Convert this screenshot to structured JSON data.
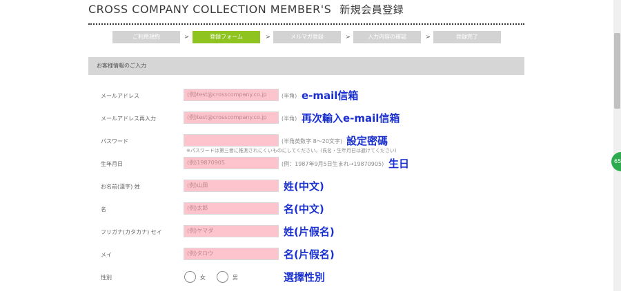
{
  "header": {
    "title": "CROSS COMPANY COLLECTION MEMBER'S",
    "title_jp": "新規会員登録"
  },
  "steps": [
    {
      "label": "ご利用規約",
      "active": false
    },
    {
      "label": "登録フォーム",
      "active": true
    },
    {
      "label": "メルマガ登録",
      "active": false
    },
    {
      "label": "入力内容の確認",
      "active": false
    },
    {
      "label": "登録完了",
      "active": false
    }
  ],
  "step_separator": ">",
  "section": {
    "title": "お客様情報のご入力"
  },
  "fields": {
    "email": {
      "label": "メールアドレス",
      "placeholder": "(例)test@crosscompany.co.jp",
      "hint": "(半角)",
      "annotation": "e-mail信箱"
    },
    "email_confirm": {
      "label": "メールアドレス再入力",
      "placeholder": "(例)test@crosscompany.co.jp",
      "hint": "(半角)",
      "annotation": "再次輸入e-mail信箱"
    },
    "password": {
      "label": "パスワード",
      "placeholder": "",
      "hint": "(半角英数字 8～20文字)",
      "annotation": "設定密碼",
      "note": "※パスワードは第三者に推測されにくいものにしてください。(氏名・生年月日は避けてください)"
    },
    "birthday": {
      "label": "生年月日",
      "placeholder": "(例)19870905",
      "hint": "(例：1987年9月5日生まれ→19870905)",
      "annotation": "生日"
    },
    "last_name": {
      "label": "お名前(漢字) 姓",
      "placeholder": "(例)山田",
      "annotation": "姓(中文)"
    },
    "first_name": {
      "label": "名",
      "placeholder": "(例)太郎",
      "annotation": "名(中文)"
    },
    "last_name_kana": {
      "label": "フリガナ(カタカナ) セイ",
      "placeholder": "(例)ヤマダ",
      "annotation": "姓(片假名)"
    },
    "first_name_kana": {
      "label": "メイ",
      "placeholder": "(例)タロウ",
      "annotation": "名(片假名)"
    },
    "gender": {
      "label": "性別",
      "option_female": "女",
      "option_male": "男",
      "annotation": "選擇性別"
    }
  },
  "badge": {
    "text": "65"
  },
  "colors": {
    "active_step": "#8fc31f",
    "inactive_step": "#d3d3d3",
    "input_bg": "#fdc4ce",
    "annotation": "#1a30ce"
  }
}
